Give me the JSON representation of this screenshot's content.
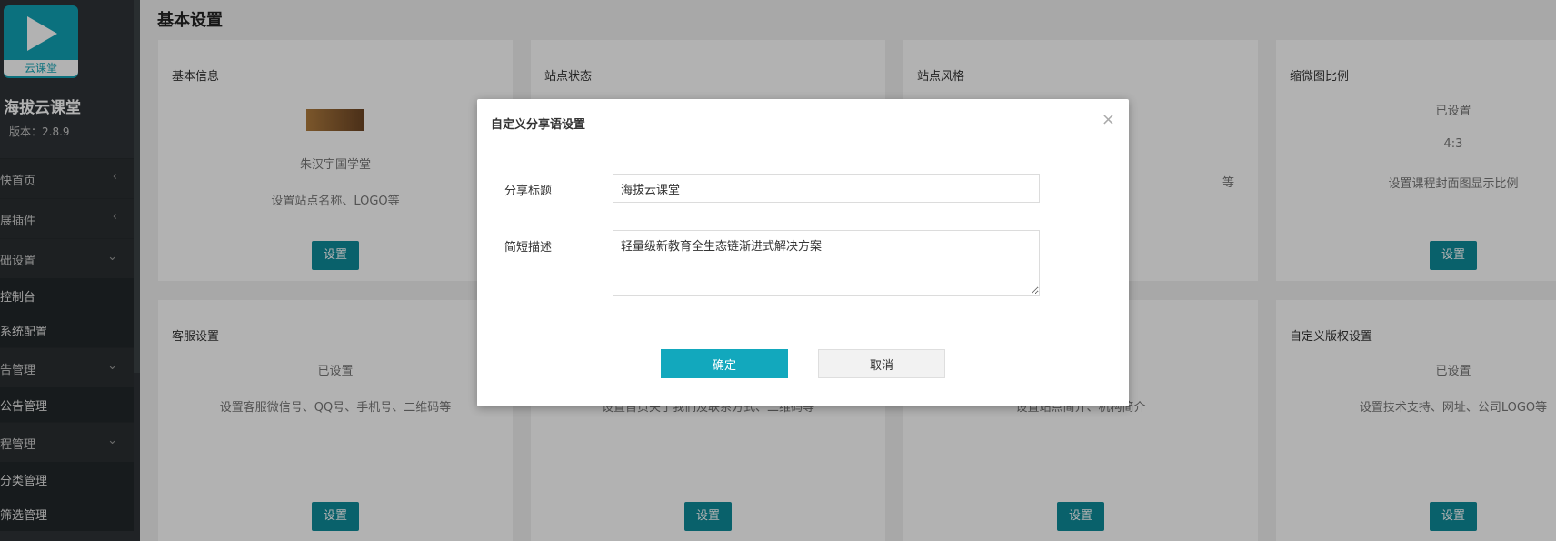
{
  "sidebar": {
    "logo_text": "云课堂",
    "app_name": "海拔云课堂",
    "version": "版本：2.8.9",
    "groups": [
      {
        "label": "快首页",
        "chevron": "‹"
      },
      {
        "label": "展插件",
        "chevron": "‹"
      },
      {
        "label": "础设置",
        "chevron": "⌄"
      },
      {
        "label": "告管理",
        "chevron": "⌄"
      },
      {
        "label": "程管理",
        "chevron": "⌄"
      }
    ],
    "subitems": [
      "控制台",
      "系统配置",
      "公告管理",
      "分类管理",
      "筛选管理"
    ]
  },
  "main": {
    "title": "基本设置",
    "cards": [
      {
        "title": "基本信息",
        "line1": "朱汉宇国学堂",
        "line2": "设置站点名称、LOGO等",
        "button": "设置"
      },
      {
        "title": "站点状态",
        "button": "设置"
      },
      {
        "title": "站点风格",
        "line2": "等",
        "button": "设置"
      },
      {
        "title": "缩微图比例",
        "line1": "已设置",
        "line_mid": "4:3",
        "line2": "设置课程封面图显示比例",
        "button": "设置"
      },
      {
        "title": "客服设置",
        "line1": "已设置",
        "line2": "设置客服微信号、QQ号、手机号、二维码等",
        "button": "设置"
      },
      {
        "title": "",
        "line2": "设置首页关于我们及联系方式、二维码等",
        "button": "设置"
      },
      {
        "title": "",
        "line2": "设置站点简介、机构简介",
        "button": "设置"
      },
      {
        "title": "自定义版权设置",
        "line1": "已设置",
        "line2": "设置技术支持、网址、公司LOGO等",
        "button": "设置"
      }
    ]
  },
  "modal": {
    "title": "自定义分享语设置",
    "close_icon": "×",
    "share_title_label": "分享标题",
    "share_title_value": "海拔云课堂",
    "desc_label": "简短描述",
    "desc_value": "轻量级新教育全生态链渐进式解决方案",
    "ok_label": "确定",
    "cancel_label": "取消"
  }
}
